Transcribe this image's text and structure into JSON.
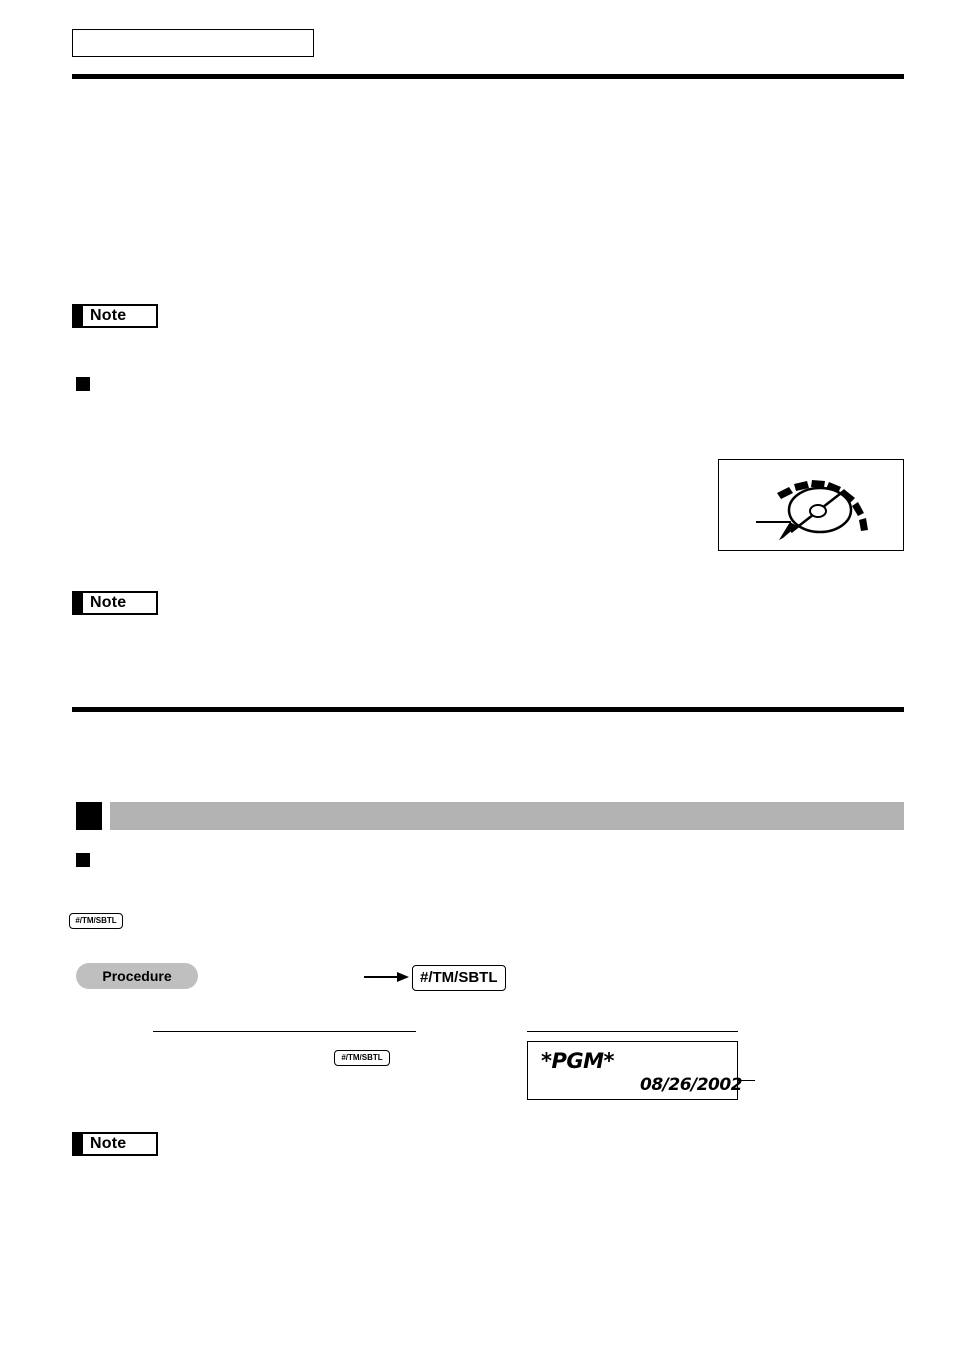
{
  "page": {
    "header_box_label": "",
    "notes": [
      {
        "label": "Note"
      },
      {
        "label": "Note"
      },
      {
        "label": "Note"
      }
    ],
    "section": {
      "band_title": "",
      "bullet": ""
    },
    "procedure": {
      "label": "Procedure"
    },
    "keys": {
      "subtotal_small": "#/TM/SBTL",
      "subtotal_large": "#/TM/SBTL",
      "subtotal_small2": "#/TM/SBTL"
    },
    "display": {
      "mode_text": "*PGM*",
      "date_text": "08/26/2002"
    },
    "icons": {
      "mode_dial": "mode-dial-icon",
      "arrow": "arrow-right-icon"
    },
    "colors": {
      "band_gray": "#b3b3b3",
      "pill_gray": "#bfbfbf",
      "rule_black": "#000000"
    }
  }
}
